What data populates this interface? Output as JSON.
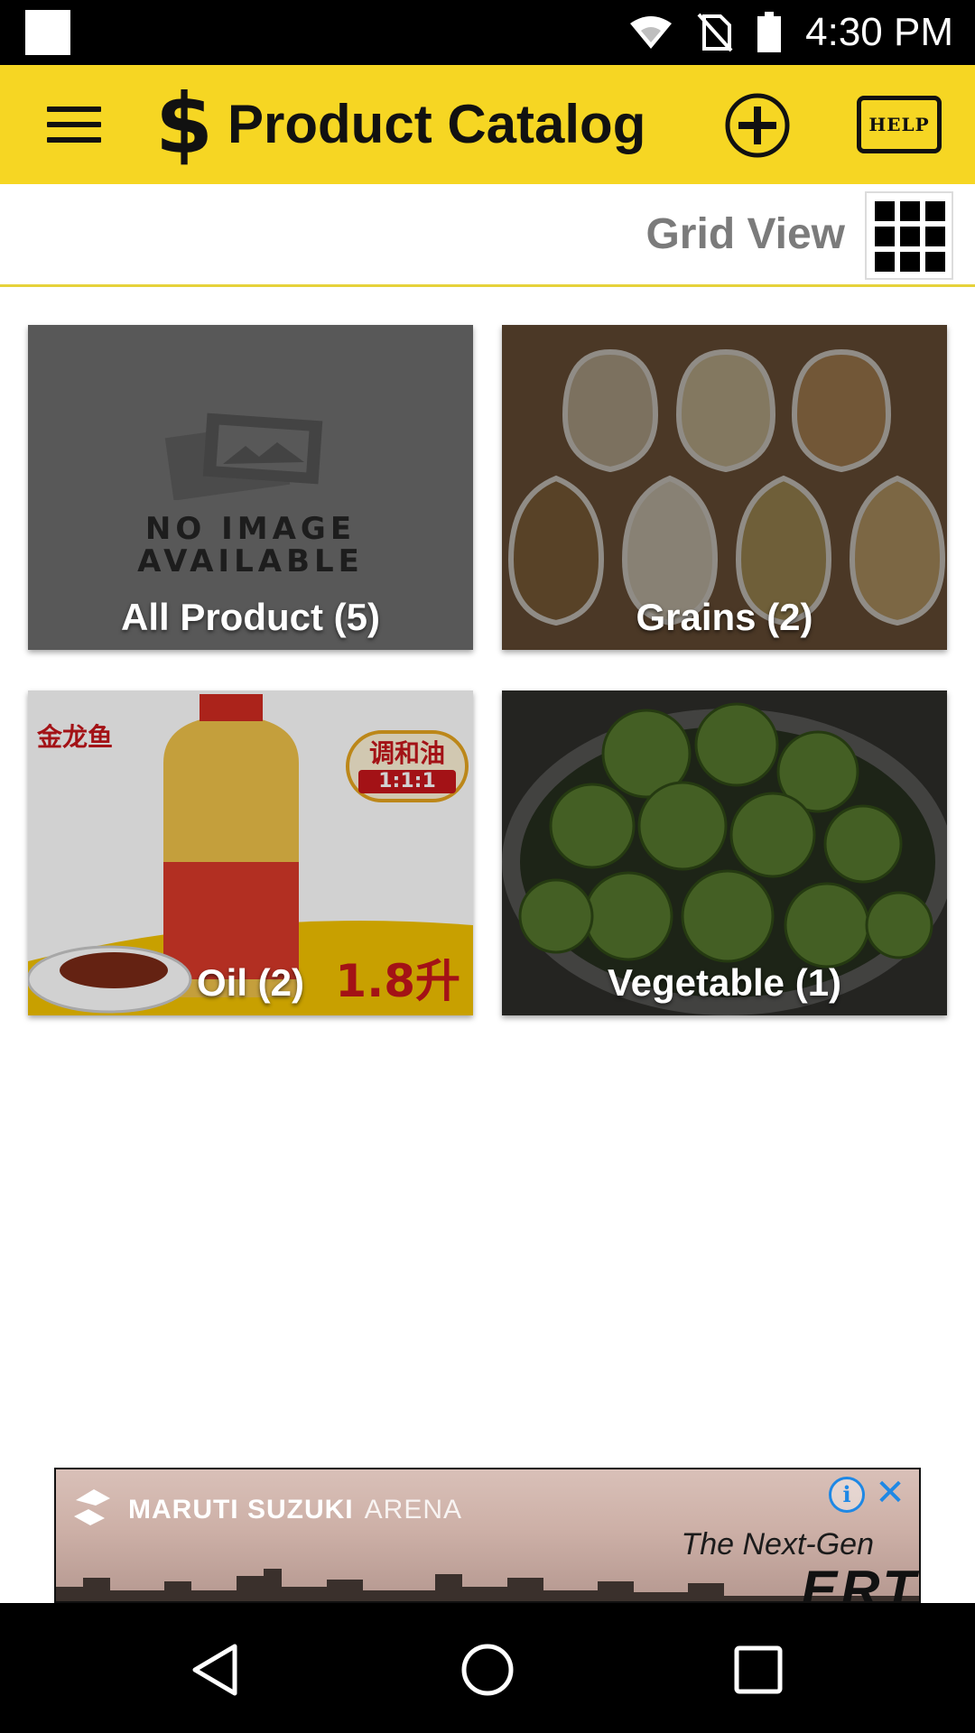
{
  "status_bar": {
    "time": "4:30 PM",
    "icons": [
      "notification-icon",
      "wifi-icon",
      "no-sim-icon",
      "battery-icon"
    ]
  },
  "app_bar": {
    "title": "Product Catalog",
    "help_label": "HELP",
    "accent_color": "#f6d623"
  },
  "view_bar": {
    "label": "Grid View"
  },
  "categories": [
    {
      "label": "All Product (5)",
      "placeholder_text": "NO IMAGE AVAILABLE"
    },
    {
      "label": "Grains (2)"
    },
    {
      "label": "Oil (2)",
      "brand_text": "金龙鱼",
      "badge_text": "调和油",
      "badge_ratio": "1:1:1",
      "volume_text": "1.8升"
    },
    {
      "label": "Vegetable (1)"
    }
  ],
  "ad": {
    "brand": "MARUTI SUZUKI",
    "brand_sub": "ARENA",
    "tagline": "The Next-Gen",
    "big_text": "ERT"
  }
}
